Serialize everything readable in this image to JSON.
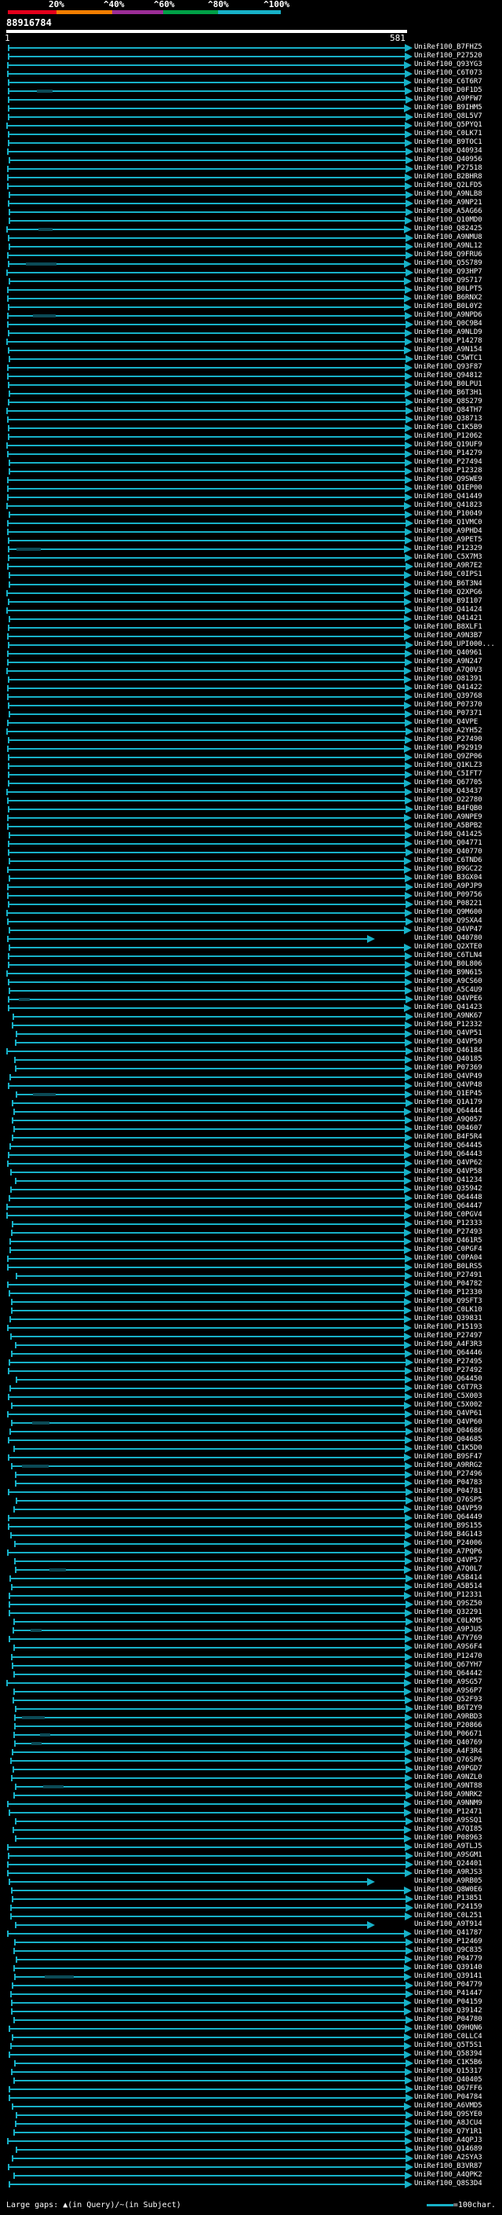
{
  "colorbar": {
    "labels": [
      "20%",
      "^40%",
      "^60%",
      "^80%",
      "^100%"
    ],
    "colors": [
      "#e3001b",
      "#f07d00",
      "#9b2d96",
      "#00a046",
      "#17b1c8"
    ]
  },
  "query": {
    "name": "88916784",
    "start_coord": "1",
    "end_coord": "581"
  },
  "hits": [
    "UniRef100_B7FHZ5",
    "UniRef100_P27520",
    "UniRef100_Q93YG3",
    "UniRef100_C6T073",
    "UniRef100_C6T6R7",
    "UniRef100_D0F1D5",
    "UniRef100_A9PFW7",
    "UniRef100_B9IHM5",
    "UniRef100_Q8L5V7",
    "UniRef100_Q5PYQ1",
    "UniRef100_C0LK71",
    "UniRef100_B9TOC1",
    "UniRef100_Q40934",
    "UniRef100_Q40956",
    "UniRef100_P27518",
    "UniRef100_B2BHR8",
    "UniRef100_Q2LFD5",
    "UniRef100_A9NLB8",
    "UniRef100_A9NP21",
    "UniRef100_A5AG66",
    "UniRef100_Q10MD0",
    "UniRef100_Q82425",
    "UniRef100_A9NMU8",
    "UniRef100_A9NL12",
    "UniRef100_Q9FRU6",
    "UniRef100_Q5S789",
    "UniRef100_Q93HP7",
    "UniRef100_Q9S717",
    "UniRef100_B0LPT5",
    "UniRef100_B6RNX2",
    "UniRef100_B0L0Y2",
    "UniRef100_A9NPD6",
    "UniRef100_Q0C9B4",
    "UniRef100_A9NLD9",
    "UniRef100_P14278",
    "UniRef100_A9N154",
    "UniRef100_C5WTC1",
    "UniRef100_Q93F87",
    "UniRef100_Q94812",
    "UniRef100_B0LPU1",
    "UniRef100_B6T3H1",
    "UniRef100_Q8S279",
    "UniRef100_Q84TH7",
    "UniRef100_Q38713",
    "UniRef100_C1K5B9",
    "UniRef100_P12062",
    "UniRef100_Q19UF9",
    "UniRef100_P14279",
    "UniRef100_P27494",
    "UniRef100_P12328",
    "UniRef100_Q9SWE9",
    "UniRef100_Q1EP00",
    "UniRef100_Q41449",
    "UniRef100_Q41823",
    "UniRef100_P10049",
    "UniRef100_Q1VMC0",
    "UniRef100_A9PHD4",
    "UniRef100_A9PET5",
    "UniRef100_P12329",
    "UniRef100_C5X7M3",
    "UniRef100_A9R7E2",
    "UniRef100_C0IPS1",
    "UniRef100_B6T3N4",
    "UniRef100_Q2XPG6",
    "UniRef100_B9I107",
    "UniRef100_Q41424",
    "UniRef100_Q41421",
    "UniRef100_B8XLF1",
    "UniRef100_A9N3B7",
    "UniRef100_UPI000...",
    "UniRef100_Q40961",
    "UniRef100_A9N247",
    "UniRef100_A7Q0V3",
    "UniRef100_O81391",
    "UniRef100_Q41422",
    "UniRef100_Q39768",
    "UniRef100_P07370",
    "UniRef100_P07371",
    "UniRef100_Q4VPE",
    "UniRef100_A2YH52",
    "UniRef100_P27490",
    "UniRef100_P92919",
    "UniRef100_Q9ZP06",
    "UniRef100_Q1KLZ3",
    "UniRef100_C5IFT7",
    "UniRef100_Q67705",
    "UniRef100_Q43437",
    "UniRef100_O22780",
    "UniRef100_B4FQB0",
    "UniRef100_A9NPE9",
    "UniRef100_A5BPB2",
    "UniRef100_Q41425",
    "UniRef100_Q04771",
    "UniRef100_Q40770",
    "UniRef100_C6TND6",
    "UniRef100_B9GC22",
    "UniRef100_B3GX04",
    "UniRef100_A9PJP9",
    "UniRef100_P09756",
    "UniRef100_P08221",
    "UniRef100_Q9M600",
    "UniRef100_Q9SXA4",
    "UniRef100_Q4VP47",
    "UniRef100_Q40780",
    "UniRef100_Q2XTE0",
    "UniRef100_C6TLN4",
    "UniRef100_B0L806",
    "UniRef100_B9N615",
    "UniRef100_A9CS60",
    "UniRef100_A5C4U9",
    "UniRef100_Q4VPE6",
    "UniRef100_Q41423",
    "UniRef100_A9NK67",
    "UniRef100_P12332",
    "UniRef100_Q4VP51",
    "UniRef100_Q4VP50",
    "UniRef100_Q46184",
    "UniRef100_Q40185",
    "UniRef100_P07369",
    "UniRef100_Q4VP49",
    "UniRef100_Q4VP48",
    "UniRef100_Q1EP45",
    "UniRef100_Q1A179",
    "UniRef100_Q64444",
    "UniRef100_A9Q057",
    "UniRef100_Q04607",
    "UniRef100_B4F5R4",
    "UniRef100_Q64445",
    "UniRef100_Q64443",
    "UniRef100_Q4VP62",
    "UniRef100_Q4VP58",
    "UniRef100_Q41234",
    "UniRef100_Q35942",
    "UniRef100_Q64448",
    "UniRef100_Q64447",
    "UniRef100_C0PGV4",
    "UniRef100_P12333",
    "UniRef100_P27493",
    "UniRef100_Q461R5",
    "UniRef100_C0PGF4",
    "UniRef100_C0PA04",
    "UniRef100_B0LRS5",
    "UniRef100_P27491",
    "UniRef100_P04782",
    "UniRef100_P12330",
    "UniRef100_Q9SFT3",
    "UniRef100_C0LK10",
    "UniRef100_Q39831",
    "UniRef100_P15193",
    "UniRef100_P27497",
    "UniRef100_A4F3R3",
    "UniRef100_Q64446",
    "UniRef100_P27495",
    "UniRef100_P27492",
    "UniRef100_Q64450",
    "UniRef100_C6T7R3",
    "UniRef100_C5X003",
    "UniRef100_C5X002",
    "UniRef100_Q4VP61",
    "UniRef100_Q4VP60",
    "UniRef100_Q04686",
    "UniRef100_Q04685",
    "UniRef100_C1K5D0",
    "UniRef100_B9SF47",
    "UniRef100_A9RRG2",
    "UniRef100_P27496",
    "UniRef100_P04783",
    "UniRef100_P04781",
    "UniRef100_Q76SP5",
    "UniRef100_Q4VP59",
    "UniRef100_Q64449",
    "UniRef100_B9S155",
    "UniRef100_B4G143",
    "UniRef100_P24006",
    "UniRef100_A7PQP6",
    "UniRef100_Q4VP57",
    "UniRef100_A7Q0L7",
    "UniRef100_A5B414",
    "UniRef100_A5B514",
    "UniRef100_P12331",
    "UniRef100_Q9SZ50",
    "UniRef100_Q32291",
    "UniRef100_C0LKM5",
    "UniRef100_A9PJU5",
    "UniRef100_A7Y769",
    "UniRef100_A9S6F4",
    "UniRef100_P12470",
    "UniRef100_Q67YH7",
    "UniRef100_Q64442",
    "UniRef100_A9SG57",
    "UniRef100_A9S6P7",
    "UniRef100_Q52F93",
    "UniRef100_B6T2Y9",
    "UniRef100_A9RBD3",
    "UniRef100_P20866",
    "UniRef100_P06671",
    "UniRef100_Q40769",
    "UniRef100_A4F3R4",
    "UniRef100_Q76SP6",
    "UniRef100_A9PGD7",
    "UniRef100_A9NZL0",
    "UniRef100_A9NT88",
    "UniRef100_A9NRK2",
    "UniRef100_A9NNM9",
    "UniRef100_P12471",
    "UniRef100_A9SSQ1",
    "UniRef100_A7QI85",
    "UniRef100_P08963",
    "UniRef100_A9TLJ5",
    "UniRef100_A9SGM1",
    "UniRef100_Q24401",
    "UniRef100_A9RJS3",
    "UniRef100_A9RB05",
    "UniRef100_Q8W0E6",
    "UniRef100_P13851",
    "UniRef100_P24159",
    "UniRef100_C0L251",
    "UniRef100_A9T914",
    "UniRef100_Q41787",
    "UniRef100_P12469",
    "UniRef100_Q9C835",
    "UniRef100_P04779",
    "UniRef100_Q39140",
    "UniRef100_Q39141",
    "UniRef100_P04779",
    "UniRef100_P41447",
    "UniRef100_P04159",
    "UniRef100_Q39142",
    "UniRef100_P04780",
    "UniRef100_Q9HQN6",
    "UniRef100_C0LLC4",
    "UniRef100_Q5T5S1",
    "UniRef100_Q58394",
    "UniRef100_C1K5B6",
    "UniRef100_Q15317",
    "UniRef100_Q40405",
    "UniRef100_Q67FF6",
    "UniRef100_P04784",
    "UniRef100_A6VMD5",
    "UniRef100_Q9SYE0",
    "UniRef100_A8JCU4",
    "UniRef100_Q7Y1R1",
    "UniRef100_A4QPJ3",
    "UniRef100_Q14689",
    "UniRef100_A2SYA3",
    "UniRef100_B3VR87",
    "UniRef100_A4QPK2",
    "UniRef100_Q8S3D4"
  ],
  "legend": {
    "left_text": "Large gaps: ▲(in Query)/~(in Subject)",
    "right_text": "=100char."
  }
}
